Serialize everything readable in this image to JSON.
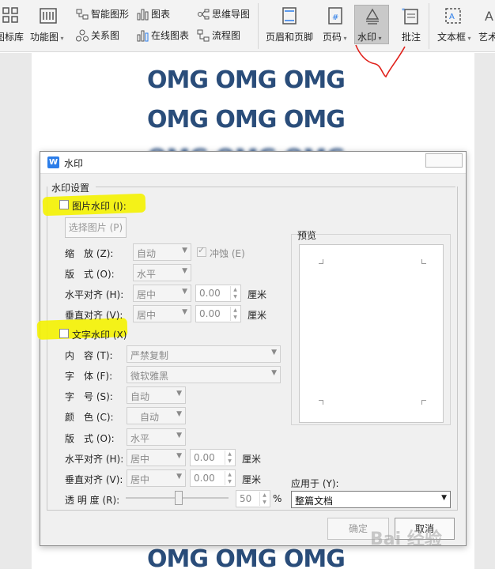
{
  "ribbon": {
    "large": [
      {
        "label": "图标库"
      },
      {
        "label": "功能图"
      },
      {
        "label": "页眉和页脚"
      },
      {
        "label": "页码"
      },
      {
        "label": "水印"
      },
      {
        "label": "批注"
      },
      {
        "label": "文本框"
      },
      {
        "label": "艺术"
      }
    ],
    "small": [
      {
        "label": "智能图形"
      },
      {
        "label": "图表"
      },
      {
        "label": "思维导图"
      },
      {
        "label": "关系图"
      },
      {
        "label": "在线图表"
      },
      {
        "label": "流程图"
      }
    ]
  },
  "document": {
    "lines": [
      "OMG OMG OMG",
      "OMG OMG OMG",
      "OMG OMG OMG",
      "OMG OMG OMG"
    ]
  },
  "dialog": {
    "title": "水印",
    "group_title": "水印设置",
    "picture": {
      "checkbox_label": "图片水印 (I):",
      "select_button": "选择图片 (P)",
      "scale_label": "缩　放 (Z):",
      "scale_value": "自动",
      "washout_label": "冲蚀 (E)",
      "layout_label": "版　式 (O):",
      "layout_value": "水平",
      "halign_label": "水平对齐 (H):",
      "halign_value": "居中",
      "halign_num": "0.00",
      "valign_label": "垂直对齐 (V):",
      "valign_value": "居中",
      "valign_num": "0.00",
      "unit": "厘米"
    },
    "text": {
      "checkbox_label": "文字水印 (X)",
      "content_label": "内　容 (T):",
      "content_value": "严禁复制",
      "font_label": "字　体 (F):",
      "font_value": "微软雅黑",
      "size_label": "字　号 (S):",
      "size_value": "自动",
      "color_label": "颜　色 (C):",
      "color_value": "自动",
      "layout_label": "版　式 (O):",
      "layout_value": "水平",
      "halign_label": "水平对齐 (H):",
      "halign_value": "居中",
      "halign_num": "0.00",
      "valign_label": "垂直对齐 (V):",
      "valign_value": "居中",
      "valign_num": "0.00",
      "unit": "厘米",
      "opacity_label": "透 明 度 (R):",
      "opacity_value": "50",
      "opacity_unit": "%",
      "opacity_level": 0.5
    },
    "preview_label": "预览",
    "apply_label": "应用于 (Y):",
    "apply_value": "整篇文档",
    "ok": "确定",
    "cancel": "取消"
  },
  "site_watermark": "Bai 经验"
}
